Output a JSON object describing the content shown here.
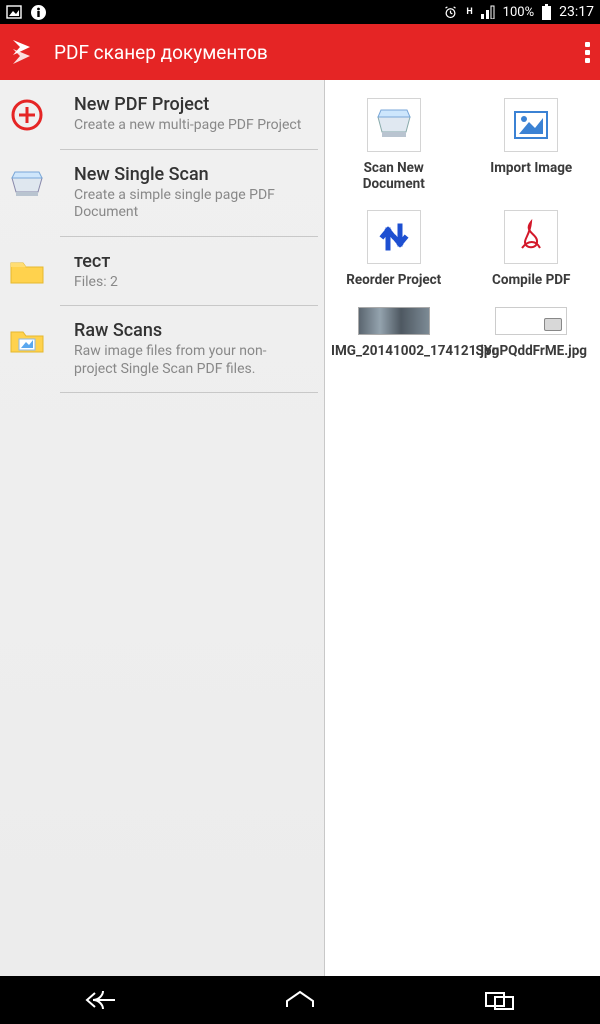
{
  "status": {
    "battery_pct": "100%",
    "clock": "23:17",
    "net_1": "H",
    "net_2": ""
  },
  "appbar": {
    "title": "PDF сканер документов"
  },
  "left_items": [
    {
      "title": "New PDF Project",
      "sub": "Create a new multi-page PDF Project"
    },
    {
      "title": "New Single Scan",
      "sub": "Create a simple single page PDF Document"
    },
    {
      "title": "тест",
      "sub": "Files: 2"
    },
    {
      "title": "Raw Scans",
      "sub": "Raw image files from your non-project Single Scan PDF files."
    }
  ],
  "right_actions": [
    {
      "label": "Scan New Document"
    },
    {
      "label": "Import Image"
    },
    {
      "label": "Reorder Project"
    },
    {
      "label": "Compile PDF"
    }
  ],
  "right_files": [
    {
      "label": "IMG_20141002_174121.jpg"
    },
    {
      "label": "SYnPQddFrME.jpg"
    }
  ]
}
